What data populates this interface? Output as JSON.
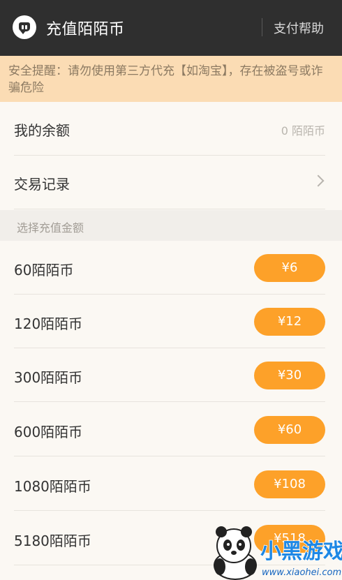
{
  "header": {
    "title": "充值陌陌币",
    "help_label": "支付帮助"
  },
  "warning": {
    "text": "安全提醒：请勿使用第三方代充【如淘宝】，存在被盗号或诈骗危险"
  },
  "balance": {
    "label": "我的余额",
    "value": "0 陌陌币"
  },
  "transactions": {
    "label": "交易记录"
  },
  "section": {
    "title": "选择充值金额"
  },
  "packages": [
    {
      "name": "60陌陌币",
      "price": "¥6"
    },
    {
      "name": "120陌陌币",
      "price": "¥12"
    },
    {
      "name": "300陌陌币",
      "price": "¥30"
    },
    {
      "name": "600陌陌币",
      "price": "¥60"
    },
    {
      "name": "1080陌陌币",
      "price": "¥108"
    },
    {
      "name": "5180陌陌币",
      "price": "¥518"
    }
  ],
  "watermark": {
    "brand": "小黑游戏",
    "url": "www.xiaohei.com"
  },
  "colors": {
    "topbar": "#2f2f2f",
    "warning_bg": "#fbdcb4",
    "accent": "#fda129",
    "page_bg": "#fbf8f3"
  }
}
